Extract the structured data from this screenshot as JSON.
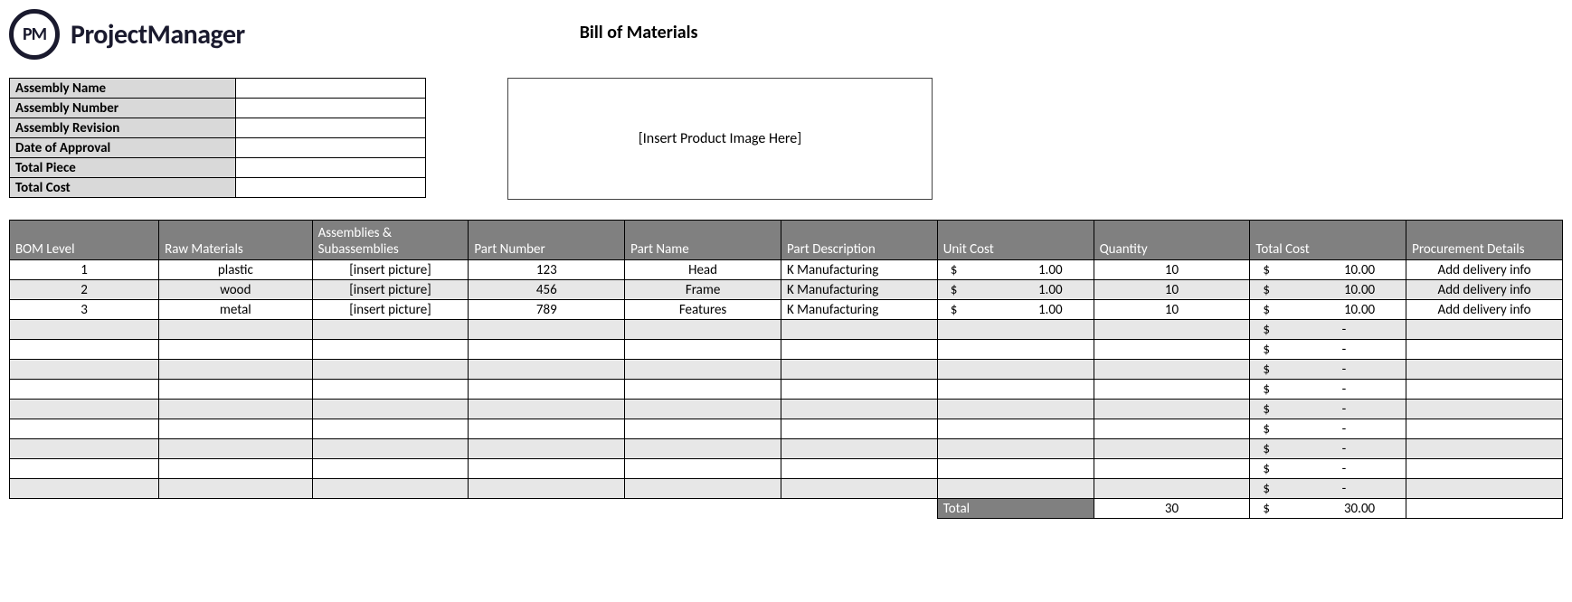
{
  "brand": {
    "logo_abbrev": "PM",
    "logo_text": "ProjectManager"
  },
  "title": "Bill of Materials",
  "meta_labels": {
    "assembly_name": "Assembly Name",
    "assembly_number": "Assembly Number",
    "assembly_revision": "Assembly Revision",
    "date_of_approval": "Date of Approval",
    "total_piece": "Total Piece",
    "total_cost": "Total Cost"
  },
  "meta_values": {
    "assembly_name": "",
    "assembly_number": "",
    "assembly_revision": "",
    "date_of_approval": "",
    "total_piece": "",
    "total_cost": ""
  },
  "image_placeholder": "[Insert Product Image Here]",
  "columns": {
    "bom_level": "BOM Level",
    "raw_materials": "Raw Materials",
    "assemblies": "Assemblies & Subassemblies",
    "part_number": "Part Number",
    "part_name": "Part Name",
    "part_description": "Part Description",
    "unit_cost": "Unit Cost",
    "quantity": "Quantity",
    "total_cost": "Total Cost",
    "procurement": "Procurement Details"
  },
  "currency_symbol": "$",
  "rows": [
    {
      "level": "1",
      "raw": "plastic",
      "asm": "[insert picture]",
      "partnum": "123",
      "partname": "Head",
      "desc": "K Manufacturing",
      "unit": "1.00",
      "qty": "10",
      "total": "10.00",
      "proc": "Add delivery info"
    },
    {
      "level": "2",
      "raw": "wood",
      "asm": "[insert picture]",
      "partnum": "456",
      "partname": "Frame",
      "desc": "K Manufacturing",
      "unit": "1.00",
      "qty": "10",
      "total": "10.00",
      "proc": "Add delivery info"
    },
    {
      "level": "3",
      "raw": "metal",
      "asm": "[insert picture]",
      "partnum": "789",
      "partname": "Features",
      "desc": "K Manufacturing",
      "unit": "1.00",
      "qty": "10",
      "total": "10.00",
      "proc": "Add delivery info"
    }
  ],
  "empty_dash": "-",
  "footer": {
    "label": "Total",
    "qty": "30",
    "total": "30.00"
  }
}
